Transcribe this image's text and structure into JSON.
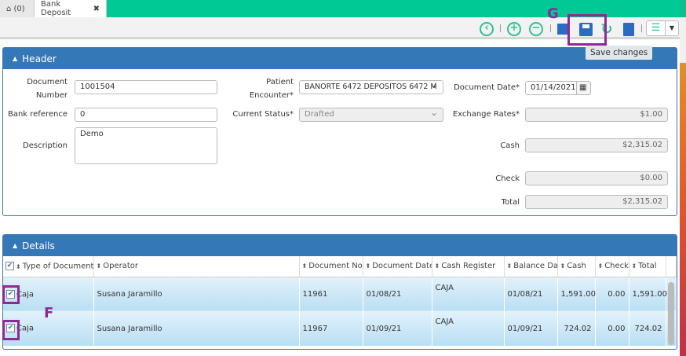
{
  "tabs": {
    "home_label": "(0)",
    "active_label": "Bank Deposit",
    "close": "✖"
  },
  "toolbar": {
    "tooltip": "Save changes"
  },
  "annotations": {
    "g": "G",
    "f": "F"
  },
  "header": {
    "title": "Header",
    "doc_number_label": "Document Number",
    "doc_number": "1001504",
    "bank_ref_label": "Bank reference",
    "bank_ref": "0",
    "description_label": "Description",
    "description": "Demo",
    "patient_label": "Patient Encounter*",
    "patient": "BANORTE 6472 DEPOSITOS 6472 M",
    "status_label": "Current Status*",
    "status": "Drafted",
    "doc_date_label": "Document Date*",
    "doc_date": "01/14/2021",
    "exchange_label": "Exchange Rates*",
    "exchange": "$1.00",
    "cash_label": "Cash",
    "cash": "$2,315.02",
    "check_label": "Check",
    "check": "$0.00",
    "total_label": "Total",
    "total": "$2,315.02"
  },
  "details": {
    "title": "Details",
    "columns": [
      "Type of Document",
      "Operator",
      "Document No.",
      "Document Date",
      "Cash Register",
      "Balance Date",
      "Cash",
      "Check",
      "Total"
    ],
    "rows": [
      [
        "Caja",
        "Susana Jaramillo",
        "11961",
        "01/08/21",
        "CAJA",
        "01/08/21",
        "1,591.00",
        "0.00",
        "1,591.00"
      ],
      [
        "Caja",
        "Susana Jaramillo",
        "11967",
        "01/09/21",
        "CAJA",
        "01/09/21",
        "724.02",
        "0.00",
        "724.02"
      ]
    ]
  }
}
